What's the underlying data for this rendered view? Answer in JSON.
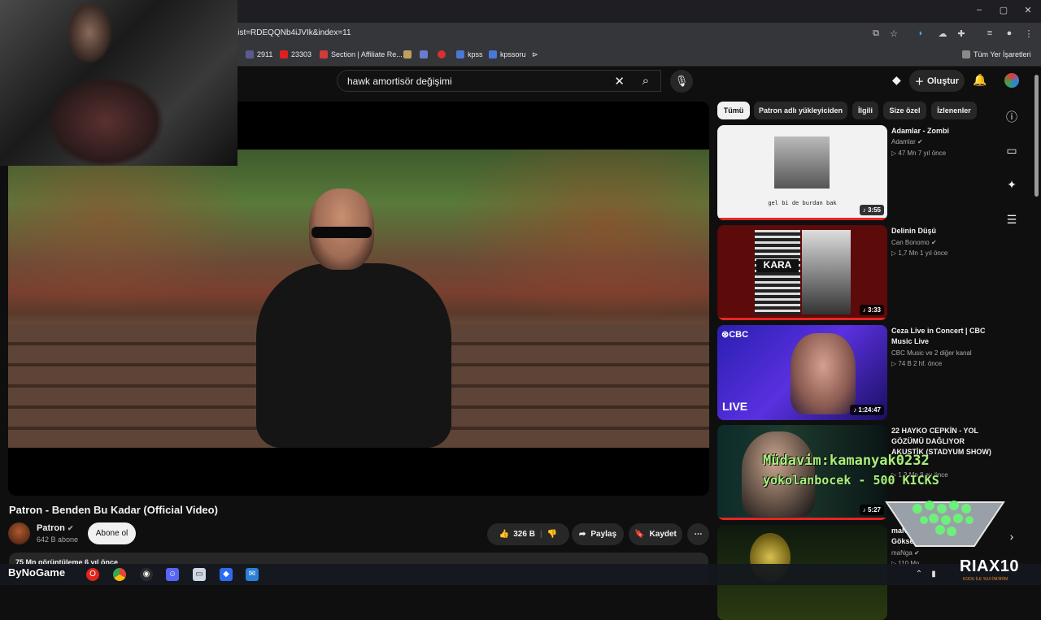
{
  "browser": {
    "url": "list=RDEQQNb4iJVIk&index=11",
    "window_controls": [
      "–",
      "▢",
      "✕"
    ],
    "bookmarks": [
      {
        "label": "2911",
        "color": "#5b5b8a"
      },
      {
        "label": "23303",
        "color": "#e02020"
      },
      {
        "label": "Section | Affiliate Re...",
        "color": "#d23b3b"
      },
      {
        "label": "",
        "color": "#c0a060"
      },
      {
        "label": "",
        "color": "#6a7bd0"
      },
      {
        "label": "",
        "color": "#d93030"
      },
      {
        "label": "kpss",
        "color": "#4a78d8"
      },
      {
        "label": "kpssoru",
        "color": "#4a78d8"
      }
    ],
    "all_bookmarks_label": "Tüm Yer İşaretleri"
  },
  "youtube": {
    "search_value": "hawk amortisör değişimi",
    "create_label": "Oluştur",
    "video": {
      "title": "Patron - Benden Bu Kadar (Official Video)",
      "channel": "Patron",
      "subscribers": "642 B abone",
      "subscribe_label": "Abone ol",
      "likes": "326 B",
      "share_label": "Paylaş",
      "save_label": "Kaydet",
      "views_line": "75 Mn görüntüleme 6 yıl önce"
    },
    "chips": [
      "Tümü",
      "Patron adlı yükleyiciden",
      "İlgili",
      "Size özel",
      "İzlenenler"
    ],
    "recommendations": [
      {
        "title": "Adamlar - Zombi",
        "channel": "Adamlar",
        "meta": "47 Mn  7 yıl önce",
        "duration": "3:55",
        "thumb_caption": "gel bi de burdan bak"
      },
      {
        "title": "Delinin Düşü",
        "channel": "Can Bonomo",
        "meta": "1,7 Mn  1 yıl önce",
        "duration": "3:33",
        "thumb_caption": "KARA"
      },
      {
        "title": "Ceza Live in Concert | CBC Music Live",
        "channel": "CBC Music  ve 2 diğer kanal",
        "meta": "74 B  2 hf. önce",
        "duration": "1:24:47",
        "thumb_caption": "CBC",
        "thumb_caption2": "LIVE"
      },
      {
        "title": "22 HAYKO CEPKİN - YOL GÖZÜMÜ DAĞLIYOR AKUSTİK (STADYUM SHOW)",
        "channel": "",
        "meta": "1,3 Mn  8 ay önce",
        "duration": "5:27"
      },
      {
        "title": "maNga",
        "title_suffix": "ft.",
        "title2": "Göksel",
        "channel": "maNga",
        "meta": "110 Mn"
      }
    ]
  },
  "overlays": {
    "marquee": "Müdavim:kamanyak0232",
    "marquee2": "yokolanbocek - 500 KICKS",
    "brand": "RIAX10",
    "brand_sub": "KODU İLE %10 İNDİRİM",
    "streamer_label": "ByNoGame"
  }
}
